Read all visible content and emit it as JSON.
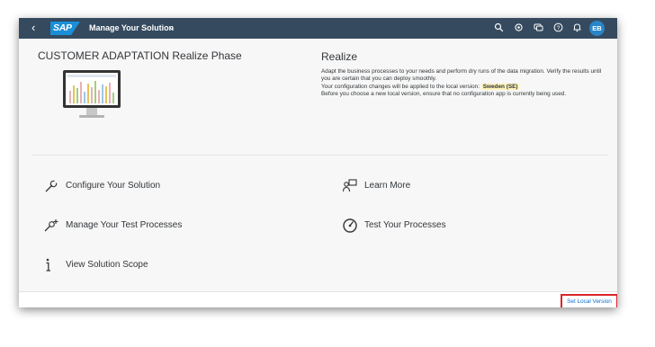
{
  "shell": {
    "back_glyph": "‹",
    "logo_text": "SAP",
    "app_title": "Manage Your Solution",
    "chevron_glyph": "⌄",
    "icons": [
      "search-icon",
      "settings-icon",
      "notes-icon",
      "help-icon",
      "notifications-icon"
    ],
    "avatar_initials": "EB"
  },
  "phase": {
    "title": "CUSTOMER ADAPTATION Realize Phase"
  },
  "realize": {
    "title": "Realize",
    "paragraph1": "Adapt the business processes to your needs and perform dry runs of the data migration. Verify the results until you are certain that you can deploy smoothly.",
    "paragraph2_prefix": "Your configuration changes will be applied to the local version:",
    "local_version": "Sweden (SE)",
    "paragraph3": "Before you choose a new local version, ensure that no configuration app is currently being used."
  },
  "tiles": {
    "configure": "Configure Your Solution",
    "learn_more": "Learn More",
    "manage_tests": "Manage Your Test Processes",
    "test_processes": "Test Your Processes",
    "view_scope": "View Solution Scope"
  },
  "footer": {
    "set_local_version": "Set Local Version"
  },
  "colors": {
    "shellbar": "#354a5f",
    "logo": "#1a8fd8",
    "avatar": "#2a85c8",
    "highlight": "#fff3b8",
    "callout_border": "#d9262b",
    "link": "#0a6ed1"
  }
}
